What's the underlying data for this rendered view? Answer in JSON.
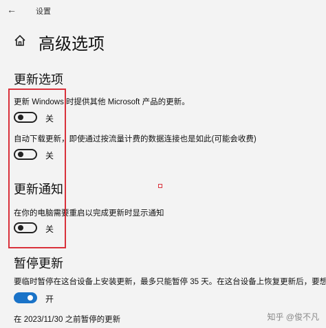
{
  "window": {
    "title": "设置",
    "back_icon": "arrow-left-icon"
  },
  "page": {
    "title": "高级选项",
    "home_icon": "home-icon"
  },
  "update_options": {
    "heading": "更新选项",
    "other_products": {
      "label": "更新 Windows 时提供其他 Microsoft 产品的更新。",
      "state": "关",
      "on": false
    },
    "metered_download": {
      "label": "自动下载更新，即使通过按流量计费的数据连接也是如此(可能会收费)",
      "state": "关",
      "on": false
    }
  },
  "update_notifications": {
    "heading": "更新通知",
    "restart_notice": {
      "label": "在你的电脑需要重启以完成更新时显示通知",
      "state": "关",
      "on": false
    }
  },
  "pause_updates": {
    "heading": "暂停更新",
    "description": "要临时暂停在这台设备上安装更新，最多只能暂停 35 天。在这台设备上恢复更新后，要想",
    "toggle": {
      "state": "开",
      "on": true
    },
    "paused_until": "在 2023/11/30 之前暂停的更新"
  },
  "watermark": "知乎 @俊不凡",
  "colors": {
    "annotation_red": "#d9303a",
    "toggle_on_blue": "#1a73c8",
    "background": "#f3f3f3"
  }
}
